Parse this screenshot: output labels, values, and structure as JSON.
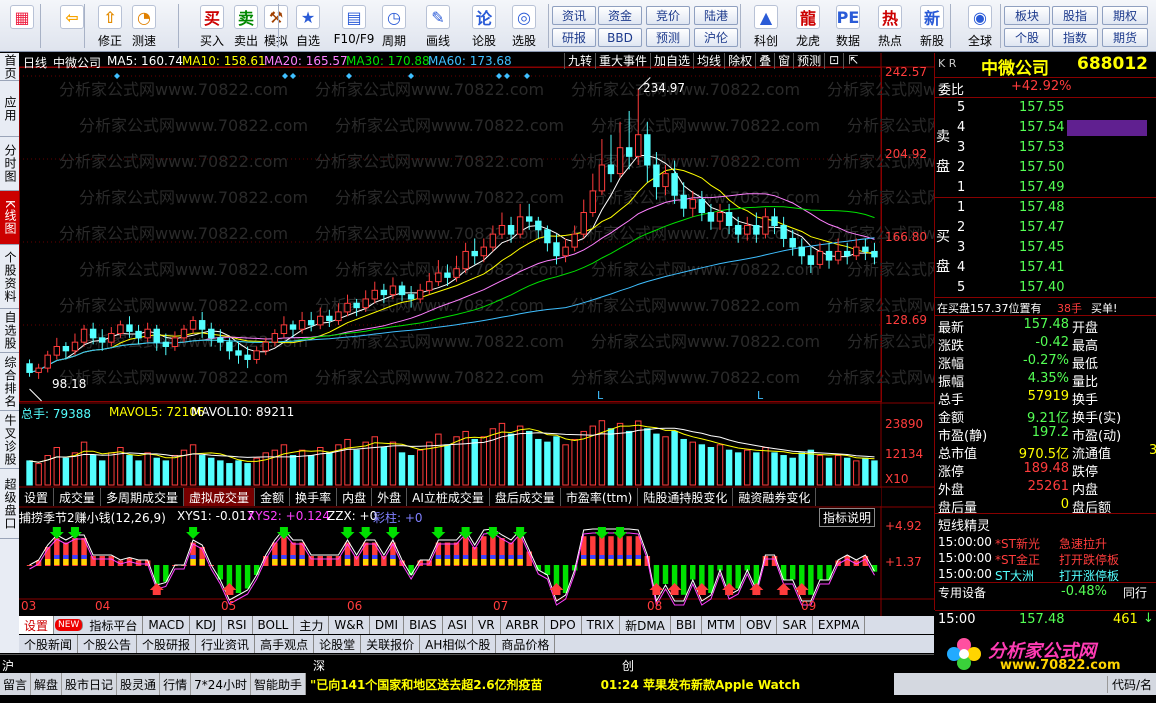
{
  "toolbar": {
    "big": [
      {
        "label": "",
        "icon": "grid-app-icon"
      },
      {
        "label": "",
        "icon": "back-arrow-icon"
      },
      {
        "label": "修正",
        "icon": "up-arrows-icon"
      },
      {
        "label": "测速",
        "icon": "speed-icon"
      },
      {
        "label": "买入",
        "icon": "buy-icon"
      },
      {
        "label": "卖出",
        "icon": "sell-icon"
      },
      {
        "label": "模拟",
        "icon": "hammer-icon"
      },
      {
        "label": "自选",
        "icon": "star-folder-icon"
      },
      {
        "label": "F10/F9",
        "icon": "f10-icon"
      },
      {
        "label": "周期",
        "icon": "clock-icon"
      },
      {
        "label": "画线",
        "icon": "pencil-icon"
      },
      {
        "label": "论股",
        "icon": "talk-icon"
      },
      {
        "label": "选股",
        "icon": "select-stock-icon"
      },
      {
        "label": "科创",
        "icon": "chart-icon"
      },
      {
        "label": "龙虎",
        "icon": "dragon-icon"
      },
      {
        "label": "数据",
        "icon": "pe-icon"
      },
      {
        "label": "热点",
        "icon": "hot-icon"
      },
      {
        "label": "新股",
        "icon": "new-stock-icon"
      },
      {
        "label": "全球",
        "icon": "globe-icon"
      }
    ],
    "small_top": [
      "资讯",
      "资金",
      "竞价",
      "陆港",
      "板块",
      "股指",
      "期权"
    ],
    "small_bot": [
      "研报",
      "BBD",
      "预测",
      "沪伦",
      "个股",
      "指数",
      "期货"
    ]
  },
  "leftnav": [
    "首页",
    "应用",
    "分时图",
    "K线图",
    "个股资料",
    "自选股",
    "综合排名",
    "牛叉诊股",
    "超级盘口"
  ],
  "header": {
    "name": "日线",
    "stock": "中微公司",
    "ma5": "MA5: 160.74",
    "ma10": "MA10: 158.61",
    "ma20": "MA20: 165.57",
    "ma30": "MA30: 170.88",
    "ma60": "MA60: 173.68",
    "tools": [
      "九转",
      "重大事件",
      "加自选",
      "均线",
      "除权",
      "叠",
      "窗",
      "预测"
    ]
  },
  "colors": {
    "up": "#ff3c3c",
    "down": "#54ffff",
    "ma5": "#ffffff",
    "ma10": "#ffff00",
    "ma20": "#ff80ff",
    "ma30": "#00e000",
    "ma60": "#3fbfff"
  },
  "watermark": "分析家公式网www.70822.com",
  "yaxis": {
    "price": [
      "242.57",
      "204.92",
      "166.80",
      "128.69"
    ],
    "vol": [
      "23890",
      "12134",
      "X10"
    ],
    "ind": [
      "+4.92",
      "+1.37"
    ]
  },
  "annotations": {
    "high": "234.97",
    "low": "98.18"
  },
  "volume": {
    "label": "总手: 79388",
    "mavol5": "MAVOL5: 72106",
    "mavol10": "MAVOL10: 89211"
  },
  "subtabs": [
    "设置",
    "成交量",
    "多周期成交量",
    "虚拟成交量",
    "金额",
    "换手率",
    "内盘",
    "外盘",
    "AI立桩成交量",
    "盘后成交量",
    "市盈率(ttm)",
    "陆股通持股变化",
    "融资融券变化"
  ],
  "indicator": {
    "name": "捕捞季节2赚小钱(12,26,9)",
    "xys1": "XYS1: -0.017",
    "xys2": "XYS2: +0.124",
    "zzx": "ZZX: +0",
    "caizhu": "彩柱: +0",
    "explain": "指标说明"
  },
  "dates": [
    "03",
    "04",
    "05",
    "06",
    "07",
    "08",
    "09"
  ],
  "indtabs": [
    "设置",
    "NEW",
    "指标平台",
    "MACD",
    "KDJ",
    "RSI",
    "BOLL",
    "主力",
    "W&R",
    "DMI",
    "BIAS",
    "ASI",
    "VR",
    "ARBR",
    "DPO",
    "TRIX",
    "新DMA",
    "BBI",
    "MTM",
    "OBV",
    "SAR",
    "EXPMA"
  ],
  "newstabs": [
    "个股新闻",
    "个股公告",
    "个股研报",
    "行业资讯",
    "高手观点",
    "论股堂",
    "关联报价",
    "AH相似个股",
    "商品价格"
  ],
  "markets": [
    "沪",
    "深",
    "创"
  ],
  "quote": {
    "kr": "K R",
    "name": "中微公司",
    "code": "688012",
    "weibi_label": "委比",
    "weibi": "+42.92%",
    "sell_label": "卖盘",
    "buy_label": "买盘",
    "sell": [
      {
        "n": "5",
        "p": "157.55",
        "v": ""
      },
      {
        "n": "4",
        "p": "157.54",
        "v": ""
      },
      {
        "n": "3",
        "p": "157.53",
        "v": ""
      },
      {
        "n": "2",
        "p": "157.50",
        "v": ""
      },
      {
        "n": "1",
        "p": "157.49",
        "v": ""
      }
    ],
    "buy": [
      {
        "n": "1",
        "p": "157.48",
        "v": ""
      },
      {
        "n": "2",
        "p": "157.47",
        "v": ""
      },
      {
        "n": "3",
        "p": "157.45",
        "v": ""
      },
      {
        "n": "4",
        "p": "157.41",
        "v": ""
      },
      {
        "n": "5",
        "p": "157.40",
        "v": ""
      }
    ],
    "notice": "在买盘157.37位置有",
    "notice2": "38手",
    "notice3": "买单!",
    "stats": [
      {
        "l1": "最新",
        "v1": "157.48",
        "l2": "开盘",
        "v2": ""
      },
      {
        "l1": "涨跌",
        "v1": "-0.42",
        "l2": "最高",
        "v2": ""
      },
      {
        "l1": "涨幅",
        "v1": "-0.27%",
        "l2": "最低",
        "v2": ""
      },
      {
        "l1": "振幅",
        "v1": "4.35%",
        "l2": "量比",
        "v2": ""
      },
      {
        "l1": "总手",
        "v1": "57919",
        "l2": "换手",
        "v2": ""
      },
      {
        "l1": "金额",
        "v1": "9.21亿",
        "l2": "换手(实)",
        "v2": ""
      },
      {
        "l1": "市盈(静)",
        "v1": "197.2",
        "l2": "市盈(动)",
        "v2": ""
      },
      {
        "l1": "总市值",
        "v1": "970.5亿",
        "l2": "流通值",
        "v2": "3"
      },
      {
        "l1": "涨停",
        "v1": "189.48",
        "l2": "跌停",
        "v2": ""
      },
      {
        "l1": "外盘",
        "v1": "25261",
        "l2": "内盘",
        "v2": ""
      },
      {
        "l1": "盘后量",
        "v1": "0",
        "l2": "盘后额",
        "v2": ""
      }
    ],
    "dxjl": "短线精灵",
    "alerts": [
      {
        "t": "15:00:00",
        "s": "*ST新光",
        "e": "急速拉升"
      },
      {
        "t": "15:00:00",
        "s": "*ST金正",
        "e": "打开跌停板"
      },
      {
        "t": "15:00:00",
        "s": "ST大洲",
        "e": "打开涨停板"
      }
    ],
    "seg1": "专用设备",
    "seg1v": "-0.48%",
    "seg2": "同行",
    "last_t": "15:00",
    "last_p": "157.48",
    "last_v": "461"
  },
  "logo": {
    "text": "分析家公式网",
    "url": "www.70822.com"
  },
  "status": {
    "items": [
      "留言",
      "解盘",
      "股市日记",
      "股灵通",
      "行情",
      "7*24小时",
      "智能助手"
    ],
    "ticker1": "\"已向141个国家和地区送去超2.6亿剂疫苗",
    "ticker2": "01:24 苹果发布新款Apple Watch",
    "right": "代码/名"
  },
  "chart_data": {
    "type": "candlestick",
    "title": "中微公司 688012 日线",
    "ylim": [
      98.18,
      242.57
    ],
    "candles": [
      [
        108,
        104,
        110,
        102
      ],
      [
        104,
        106,
        108,
        101
      ],
      [
        106,
        112,
        114,
        104
      ],
      [
        112,
        116,
        120,
        110
      ],
      [
        116,
        114,
        118,
        110
      ],
      [
        114,
        118,
        122,
        112
      ],
      [
        118,
        124,
        126,
        116
      ],
      [
        124,
        120,
        127,
        117
      ],
      [
        120,
        118,
        124,
        114
      ],
      [
        118,
        122,
        125,
        116
      ],
      [
        122,
        126,
        128,
        120
      ],
      [
        126,
        123,
        130,
        120
      ],
      [
        123,
        120,
        126,
        117
      ],
      [
        120,
        124,
        127,
        118
      ],
      [
        124,
        118,
        126,
        114
      ],
      [
        118,
        116,
        122,
        112
      ],
      [
        116,
        120,
        123,
        114
      ],
      [
        120,
        124,
        126,
        118
      ],
      [
        124,
        128,
        130,
        122
      ],
      [
        128,
        124,
        132,
        120
      ],
      [
        124,
        120,
        127,
        116
      ],
      [
        120,
        118,
        124,
        114
      ],
      [
        118,
        114,
        120,
        110
      ],
      [
        114,
        112,
        118,
        108
      ],
      [
        112,
        110,
        116,
        106
      ],
      [
        110,
        114,
        116,
        108
      ],
      [
        114,
        118,
        120,
        112
      ],
      [
        118,
        122,
        124,
        116
      ],
      [
        122,
        126,
        130,
        120
      ],
      [
        126,
        124,
        128,
        120
      ],
      [
        124,
        128,
        132,
        122
      ],
      [
        128,
        126,
        132,
        123
      ],
      [
        126,
        130,
        134,
        124
      ],
      [
        130,
        128,
        133,
        125
      ],
      [
        128,
        132,
        136,
        126
      ],
      [
        132,
        136,
        140,
        130
      ],
      [
        136,
        134,
        138,
        130
      ],
      [
        134,
        138,
        142,
        132
      ],
      [
        138,
        142,
        146,
        136
      ],
      [
        142,
        140,
        145,
        136
      ],
      [
        140,
        144,
        148,
        138
      ],
      [
        144,
        140,
        146,
        137
      ],
      [
        140,
        138,
        144,
        134
      ],
      [
        138,
        142,
        145,
        136
      ],
      [
        142,
        146,
        150,
        140
      ],
      [
        146,
        150,
        156,
        144
      ],
      [
        150,
        148,
        154,
        144
      ],
      [
        148,
        152,
        158,
        146
      ],
      [
        152,
        160,
        164,
        150
      ],
      [
        160,
        158,
        166,
        154
      ],
      [
        158,
        162,
        166,
        155
      ],
      [
        162,
        168,
        172,
        160
      ],
      [
        168,
        172,
        178,
        166
      ],
      [
        172,
        168,
        176,
        164
      ],
      [
        168,
        176,
        182,
        166
      ],
      [
        176,
        174,
        182,
        170
      ],
      [
        174,
        170,
        176,
        166
      ],
      [
        170,
        164,
        172,
        160
      ],
      [
        164,
        158,
        168,
        154
      ],
      [
        158,
        162,
        166,
        155
      ],
      [
        162,
        168,
        172,
        160
      ],
      [
        168,
        178,
        184,
        166
      ],
      [
        178,
        188,
        196,
        176
      ],
      [
        188,
        200,
        212,
        186
      ],
      [
        200,
        196,
        214,
        192
      ],
      [
        196,
        208,
        220,
        194
      ],
      [
        208,
        204,
        225,
        198
      ],
      [
        204,
        214,
        234.97,
        200
      ],
      [
        214,
        200,
        220,
        192
      ],
      [
        200,
        190,
        206,
        184
      ],
      [
        190,
        196,
        200,
        186
      ],
      [
        196,
        186,
        202,
        182
      ],
      [
        186,
        180,
        192,
        176
      ],
      [
        180,
        184,
        188,
        176
      ],
      [
        184,
        178,
        188,
        174
      ],
      [
        178,
        174,
        182,
        170
      ],
      [
        174,
        178,
        182,
        170
      ],
      [
        178,
        172,
        182,
        168
      ],
      [
        172,
        168,
        176,
        164
      ],
      [
        168,
        172,
        176,
        165
      ],
      [
        172,
        168,
        178,
        164
      ],
      [
        168,
        176,
        180,
        166
      ],
      [
        176,
        172,
        180,
        168
      ],
      [
        172,
        166,
        176,
        162
      ],
      [
        166,
        162,
        170,
        158
      ],
      [
        162,
        158,
        166,
        154
      ],
      [
        158,
        154,
        162,
        150
      ],
      [
        154,
        160,
        164,
        152
      ],
      [
        160,
        156,
        164,
        152
      ],
      [
        156,
        160,
        166,
        154
      ],
      [
        160,
        158,
        164,
        154
      ],
      [
        158,
        162,
        166,
        156
      ],
      [
        162,
        160,
        166,
        156
      ],
      [
        160,
        157.48,
        164,
        154
      ]
    ],
    "volumes": [
      9,
      8,
      11,
      14,
      10,
      12,
      16,
      11,
      9,
      12,
      14,
      11,
      9,
      12,
      10,
      9,
      11,
      13,
      15,
      11,
      10,
      9,
      8,
      9,
      8,
      10,
      12,
      13,
      15,
      11,
      13,
      11,
      14,
      12,
      15,
      17,
      13,
      16,
      18,
      14,
      16,
      12,
      11,
      13,
      16,
      19,
      15,
      18,
      20,
      17,
      18,
      21,
      23,
      19,
      22,
      20,
      17,
      16,
      18,
      15,
      17,
      20,
      22,
      24,
      21,
      23,
      20,
      23.89,
      21,
      19,
      18,
      20,
      17,
      16,
      15,
      14,
      15,
      13,
      12,
      13,
      12,
      14,
      12,
      11,
      10,
      12,
      13,
      11,
      10,
      11,
      10,
      9,
      10,
      9
    ],
    "vol_ylim": [
      0,
      23.89
    ]
  }
}
